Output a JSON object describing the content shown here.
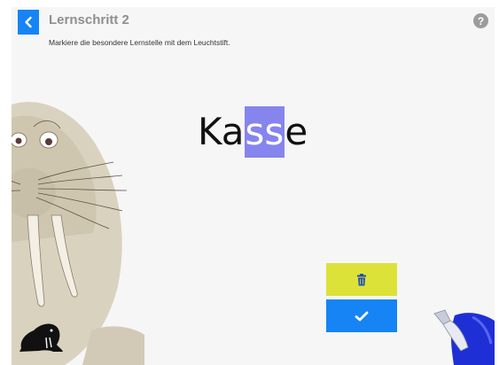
{
  "header": {
    "title": "Lernschritt 2",
    "instruction": "Markiere die besondere Lernstelle mit dem Leuchtstift.",
    "help_label": "?"
  },
  "word": {
    "prefix": "Ka",
    "highlighted": "ss",
    "suffix": "e"
  },
  "colors": {
    "primary": "#1684f5",
    "highlight": "#8685ee",
    "delete_button": "#dde238"
  },
  "icons": {
    "back": "chevron-left-icon",
    "help": "question-icon",
    "delete": "trash-icon",
    "confirm": "check-icon",
    "marker": "highlighter-marker-icon"
  }
}
